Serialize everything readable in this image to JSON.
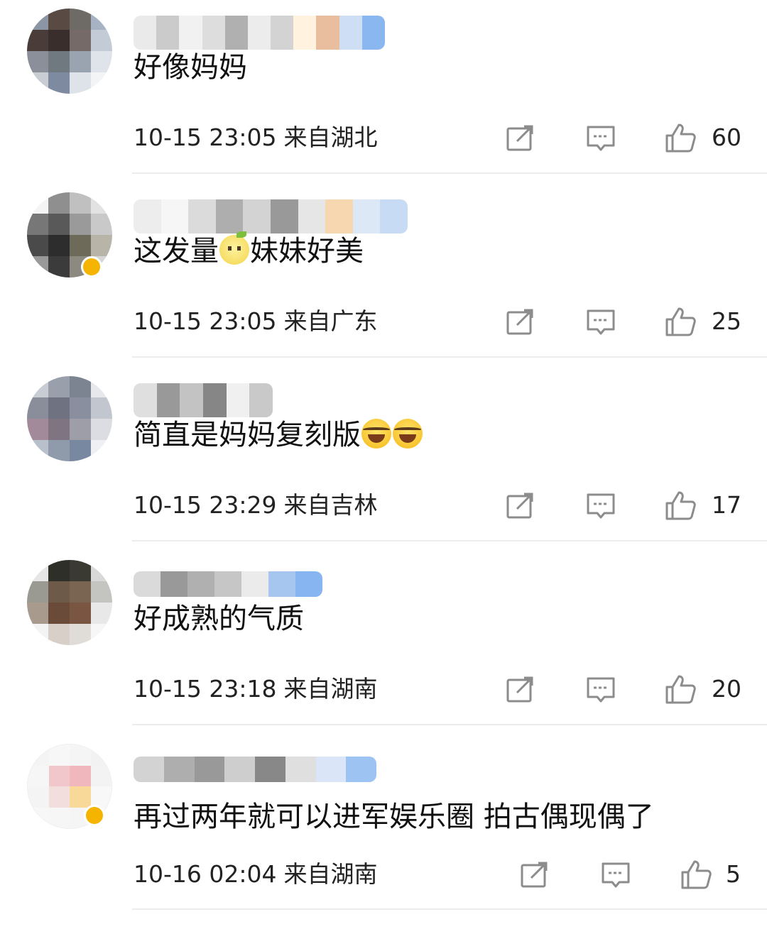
{
  "comments": [
    {
      "text": "好像妈妈",
      "time": "10-15 23:05",
      "location": "来自湖北",
      "likes": "60",
      "avatar_colors": [
        "#8c95a3",
        "#5a4a44",
        "#6e6a66",
        "#a7b3c2",
        "#4a3c38",
        "#3a2e2c",
        "#766a68",
        "#c3ccd6",
        "#8a8f99",
        "#707880",
        "#9aa4b0",
        "#dfe4ea",
        "#c7cdd3",
        "#7d8aa0",
        "#dde3e9",
        "#f2f4f6"
      ],
      "username_blocks": [
        "#e8e8e8",
        "#c6c6c6",
        "#f0f0f0",
        "#dadada",
        "#a8a8a8",
        "#ebebeb",
        "#cfcfcf",
        "#fff1dc",
        "#e6b894",
        "#c9dbf5",
        "#7fb0f0"
      ]
    },
    {
      "text_before": "这发量",
      "text_after": "妹妹好美",
      "time": "10-15 23:05",
      "location": "来自广东",
      "likes": "25",
      "avatar_colors": [
        "#f4f4f4",
        "#8f8f8f",
        "#c0c0c0",
        "#e2e2e2",
        "#777777",
        "#595959",
        "#9a9a9a",
        "#c9c9c9",
        "#4a4a4a",
        "#2d2d2d",
        "#6e6a5a",
        "#b8b4a8",
        "#999999",
        "#3b3b3b",
        "#8c8a80",
        "#d6d6d6"
      ],
      "username_blocks": [
        "#ececec",
        "#f6f6f6",
        "#d8d8d8",
        "#a6a6a6",
        "#cfcfcf",
        "#8e8e8e",
        "#e4e4e4",
        "#f7d3a8",
        "#d9e6f6",
        "#c2d8f5"
      ]
    },
    {
      "text": "简直是妈妈复刻版",
      "time": "10-15 23:29",
      "location": "来自吉林",
      "likes": "17",
      "avatar_colors": [
        "#c8ccd4",
        "#9aa0ab",
        "#7d8491",
        "#e6e8ec",
        "#8a8e9a",
        "#6f7280",
        "#8a8fa0",
        "#c2c7cf",
        "#a38a9a",
        "#7e7482",
        "#9e9ea8",
        "#dcdde2",
        "#b8c0cc",
        "#8f9aab",
        "#7888a0",
        "#eef0f3"
      ],
      "username_blocks": [
        "#dcdcdc",
        "#8f8f8f",
        "#bdbdbd",
        "#7a7a7a",
        "#efefef",
        "#c4c4c4"
      ]
    },
    {
      "text": "好成熟的气质",
      "time": "10-15 23:18",
      "location": "来自湖南",
      "likes": "20",
      "avatar_colors": [
        "#e6e6e6",
        "#2f2f2a",
        "#3a3a33",
        "#d8d8d8",
        "#9a9a92",
        "#6e5a48",
        "#7a6552",
        "#c4c4c0",
        "#a89a8c",
        "#6a4a38",
        "#7a5642",
        "#e8e8e8",
        "#f3f3f3",
        "#d8d0c8",
        "#e0dcd8",
        "#f7f7f7"
      ],
      "username_blocks": [
        "#d6d6d6",
        "#8e8e8e",
        "#a8a8a8",
        "#c0c0c0",
        "#e9e9e9",
        "#9dc0ef",
        "#7aaef0"
      ]
    },
    {
      "text": "再过两年就可以进军娱乐圈 拍古偶现偶了",
      "time": "10-16 02:04",
      "location": "来自湖南",
      "likes": "5",
      "avatar_colors": [
        "#f4f4f4",
        "#f7f7f7",
        "#f5f5f5",
        "#f2f2f2",
        "#f6f6f6",
        "#f1c7cc",
        "#f0b7bd",
        "#f3f3f3",
        "#f4f4f4",
        "#f3dede",
        "#f8d99a",
        "#f8f8f8",
        "#f7f7f7",
        "#f6f6f6",
        "#f5f5f5",
        "#f9f9f9"
      ],
      "username_blocks": [
        "#cfcfcf",
        "#a6a6a6",
        "#8f8f8f",
        "#c9c9c9",
        "#7c7c7c",
        "#dcdcdc",
        "#d6e4f7",
        "#93bdf2"
      ]
    }
  ],
  "icons": {
    "share": "share-icon",
    "reply": "comment-icon",
    "like": "thumbs-up-icon"
  },
  "colors": {
    "icon_gray": "#8c8c8c",
    "verified_gold": "#f5b400",
    "divider": "#ececec"
  }
}
